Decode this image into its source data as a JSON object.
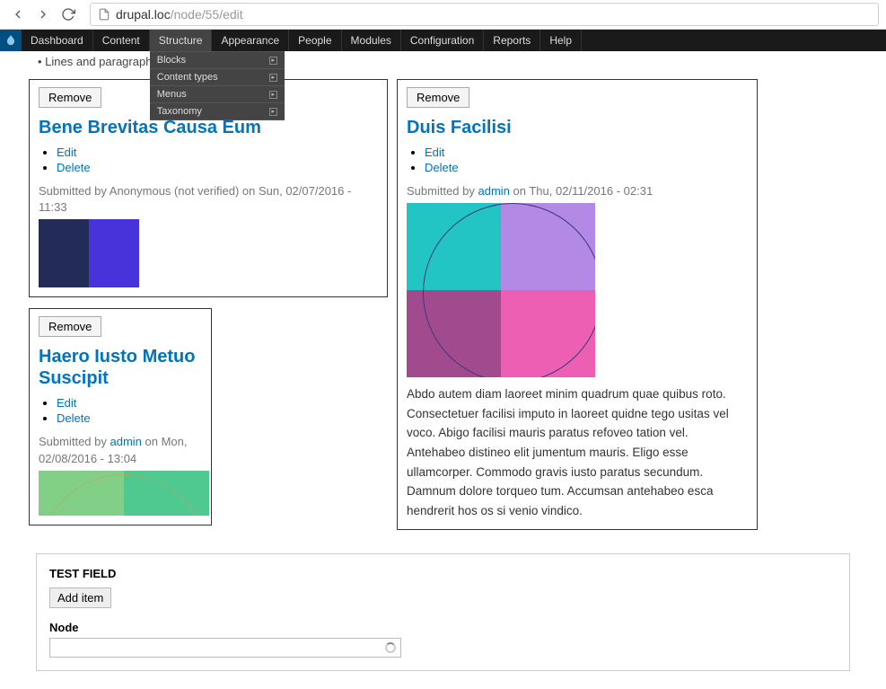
{
  "url": {
    "domain": "drupal.loc",
    "path": "/node/55/edit"
  },
  "admin_menu": {
    "items": [
      "Dashboard",
      "Content",
      "Structure",
      "Appearance",
      "People",
      "Modules",
      "Configuration",
      "Reports",
      "Help"
    ],
    "open_index": 2,
    "submenu": [
      "Blocks",
      "Content types",
      "Menus",
      "Taxonomy"
    ]
  },
  "hint_text": "Lines and paragraphs break automatically.",
  "cards": {
    "left": [
      {
        "remove": "Remove",
        "title": "Bene Brevitas Causa Eum",
        "actions": [
          "Edit",
          "Delete"
        ],
        "byline_pre": "Submitted by Anonymous (not verified) on Sun, 02/07/2016 - 11:33",
        "byline_user": "",
        "byline_post": "",
        "colors": [
          "#232c59",
          "#4733d9"
        ]
      },
      {
        "remove": "Remove",
        "title": "Haero Iusto Metuo Suscipit",
        "actions": [
          "Edit",
          "Delete"
        ],
        "byline_pre": "Submitted by ",
        "byline_user": "admin",
        "byline_post": " on Mon, 02/08/2016 - 13:04",
        "colors": [
          "#82d087",
          "#4fc98f"
        ]
      }
    ],
    "right": {
      "remove": "Remove",
      "title": "Duis Facilisi",
      "actions": [
        "Edit",
        "Delete"
      ],
      "byline_pre": "Submitted by ",
      "byline_user": "admin",
      "byline_post": " on Thu, 02/11/2016 - 02:31",
      "colors": [
        "#22c4c4",
        "#b389e6",
        "#a14a8e",
        "#ec5fb2"
      ],
      "body": "Abdo autem diam laoreet minim quadrum quae quibus roto. Consectetuer facilisi imputo in laoreet quidne tego usitas vel voco. Abigo facilisi mauris paratus refoveo tation vel. Antehabeo distineo elit jumentum mauris. Eligo esse ullamcorper. Commodo gravis iusto paratus secundum. Damnum dolore torqueo tum. Accumsan antehabeo esca hendrerit hos os si venio vindico."
    }
  },
  "form": {
    "field_label": "TEST FIELD",
    "add_item": "Add item",
    "node_label": "Node",
    "node_value": ""
  }
}
